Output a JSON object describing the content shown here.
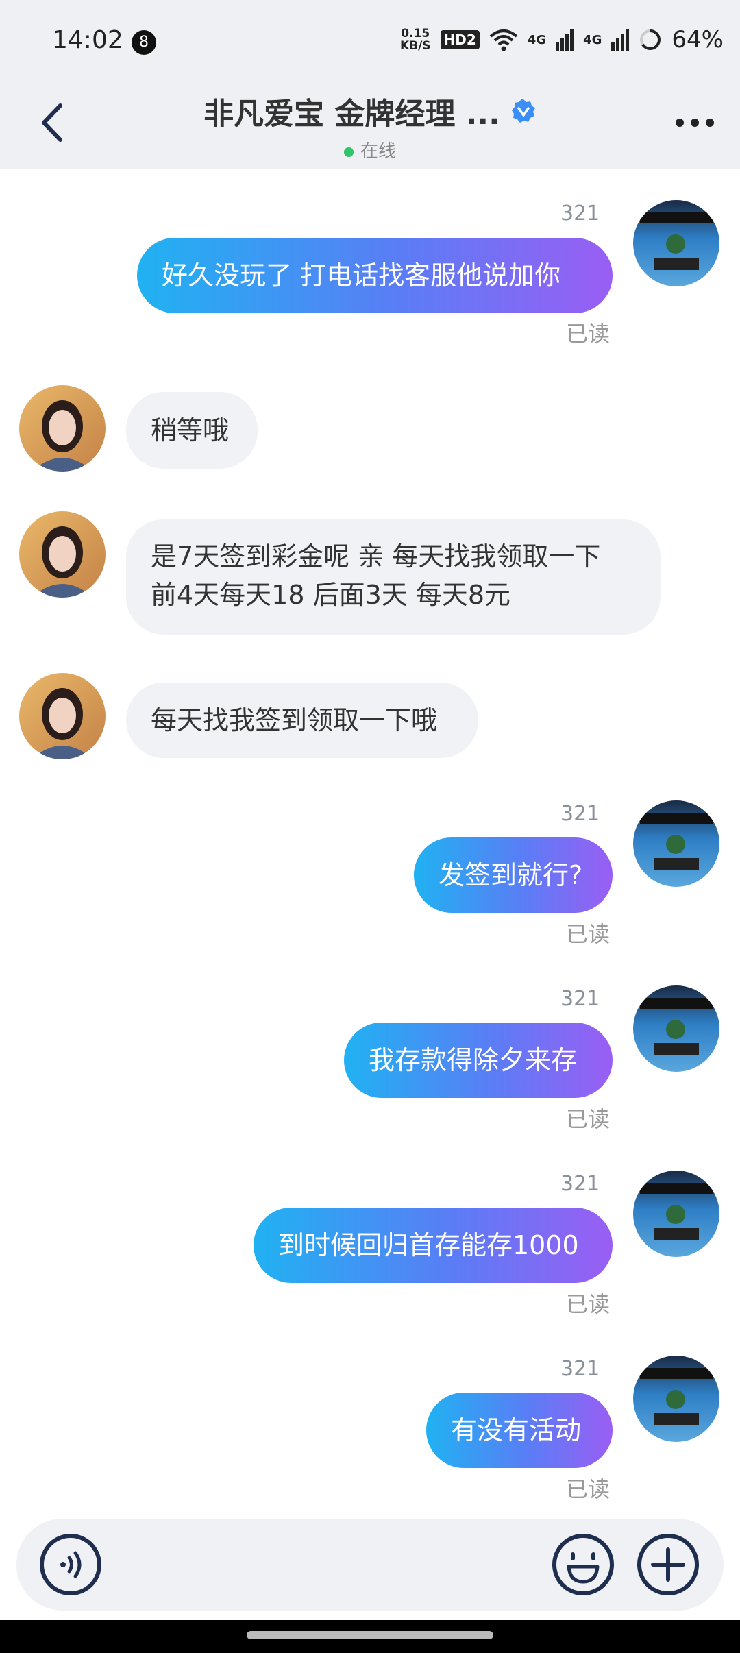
{
  "status_bar": {
    "time": "14:02",
    "notification_count": "8",
    "net_speed_value": "0.15",
    "net_speed_unit": "KB/S",
    "hd": "HD2",
    "signal_1": "4G",
    "signal_2": "4G",
    "battery": "64%"
  },
  "header": {
    "title": "非凡爱宝 金牌经理 ...",
    "presence": "在线",
    "accent_color": "#3a8ef6",
    "online_color": "#2ec46b"
  },
  "messages": [
    {
      "direction": "out",
      "sender": "321",
      "text": "好久没玩了 打电话找客服他说加你",
      "status": "已读"
    },
    {
      "direction": "in",
      "text": "稍等哦"
    },
    {
      "direction": "in",
      "lines": [
        "是7天签到彩金呢 亲 每天找我领取一下",
        "前4天每天18 后面3天 每天8元"
      ]
    },
    {
      "direction": "in",
      "text": "每天找我签到领取一下哦"
    },
    {
      "direction": "out",
      "sender": "321",
      "text": "发签到就行?",
      "status": "已读"
    },
    {
      "direction": "out",
      "sender": "321",
      "text": "我存款得除夕来存",
      "status": "已读"
    },
    {
      "direction": "out",
      "sender": "321",
      "text": "到时候回归首存能存1000",
      "status": "已读"
    },
    {
      "direction": "out",
      "sender": "321",
      "text": "有没有活动",
      "status": "已读"
    }
  ],
  "icons": {
    "back": "back-arrow-icon",
    "more": "more-dots-icon",
    "verified": "verified-check-icon",
    "voice": "voice-icon",
    "emoji": "emoji-icon",
    "plus": "plus-icon"
  }
}
